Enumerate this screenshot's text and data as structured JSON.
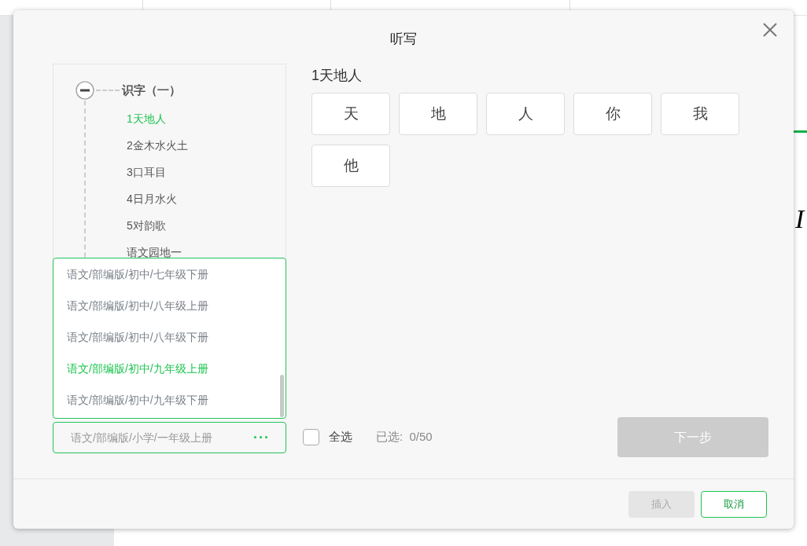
{
  "background": {
    "fragment": "I"
  },
  "dialog": {
    "title": "听写"
  },
  "tree": {
    "label": "识字（一）",
    "expanded": true,
    "children": [
      {
        "label": "1天地人",
        "selected": true
      },
      {
        "label": "2金木水火土",
        "selected": false
      },
      {
        "label": "3口耳目",
        "selected": false
      },
      {
        "label": "4日月水火",
        "selected": false
      },
      {
        "label": "5对韵歌",
        "selected": false
      },
      {
        "label": "语文园地一",
        "selected": false
      }
    ]
  },
  "book_dropdown": {
    "options": [
      {
        "label": "语文/部编版/初中/七年级下册",
        "selected": false
      },
      {
        "label": "语文/部编版/初中/八年级上册",
        "selected": false
      },
      {
        "label": "语文/部编版/初中/八年级下册",
        "selected": false
      },
      {
        "label": "语文/部编版/初中/九年级上册",
        "selected": true
      },
      {
        "label": "语文/部编版/初中/九年级下册",
        "selected": false
      }
    ]
  },
  "book_select": {
    "value": "语文/部编版/小学/一年级上册",
    "more": "···"
  },
  "lesson_title": "1天地人",
  "characters": [
    {
      "char": "天",
      "selected": false
    },
    {
      "char": "地",
      "selected": false
    },
    {
      "char": "人",
      "selected": false
    },
    {
      "char": "你",
      "selected": false
    },
    {
      "char": "我",
      "selected": false
    },
    {
      "char": "他",
      "selected": false
    }
  ],
  "select_all": {
    "label": "全选",
    "checked": false
  },
  "selected_count": "已选:  0/50",
  "next_button": {
    "label": "下一步",
    "disabled": true
  },
  "footer": {
    "buttons": [
      {
        "label": "插入",
        "kind": "secondary",
        "disabled": true
      },
      {
        "label": "取消",
        "kind": "outline",
        "disabled": false
      }
    ]
  }
}
